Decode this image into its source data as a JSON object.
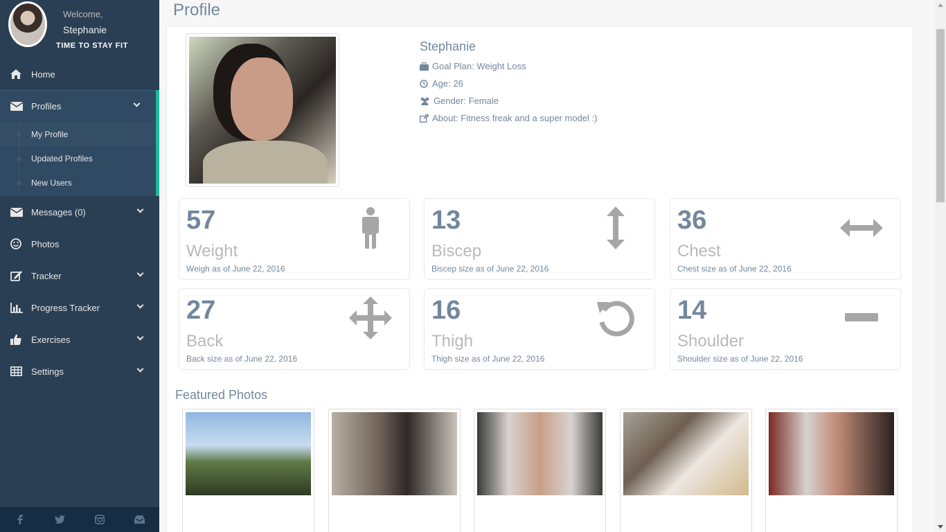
{
  "sidebar": {
    "welcome": "Welcome,",
    "username": "Stephanie",
    "tagline": "TIME TO STAY FIT",
    "menu": [
      {
        "label": "Home"
      },
      {
        "label": "Profiles",
        "submenu": [
          "My Profile",
          "Updated Profiles",
          "New Users"
        ]
      },
      {
        "label": "Messages (0)"
      },
      {
        "label": "Photos"
      },
      {
        "label": "Tracker"
      },
      {
        "label": "Progress Tracker"
      },
      {
        "label": "Exercises"
      },
      {
        "label": "Settings"
      }
    ],
    "footer_icons": [
      "facebook-icon",
      "twitter-icon",
      "instagram-icon",
      "inbox-icon"
    ]
  },
  "page": {
    "title": "Profile"
  },
  "profile": {
    "name": "Stephanie",
    "goal": "Goal Plan: Weight Loss",
    "age": "Age: 26",
    "gender": "Gender: Female",
    "about": "About: Fitness freak and a super model :)"
  },
  "stats": [
    {
      "count": "57",
      "label": "Weight",
      "sub": "Weigh as of June 22, 2016",
      "icon": "male-figure-icon"
    },
    {
      "count": "13",
      "label": "Biscep",
      "sub": "Biscep size as of June 22, 2016",
      "icon": "vertical-arrows-icon"
    },
    {
      "count": "36",
      "label": "Chest",
      "sub": "Chest size as of June 22, 2016",
      "icon": "horizontal-arrows-icon"
    },
    {
      "count": "27",
      "label": "Back",
      "sub": "Back size as of June 22, 2016",
      "icon": "move-arrows-icon"
    },
    {
      "count": "16",
      "label": "Thigh",
      "sub": "Thigh size as of June 22, 2016",
      "icon": "rotate-icon"
    },
    {
      "count": "14",
      "label": "Shoulder",
      "sub": "Shoulder size as of June 22, 2016",
      "icon": "minus-icon"
    }
  ],
  "featured": {
    "title": "Featured Photos"
  },
  "colors": {
    "sidebar": "#2a3f54",
    "accent": "#1abb9c",
    "text": "#73879c",
    "muted": "#bab8b8"
  }
}
